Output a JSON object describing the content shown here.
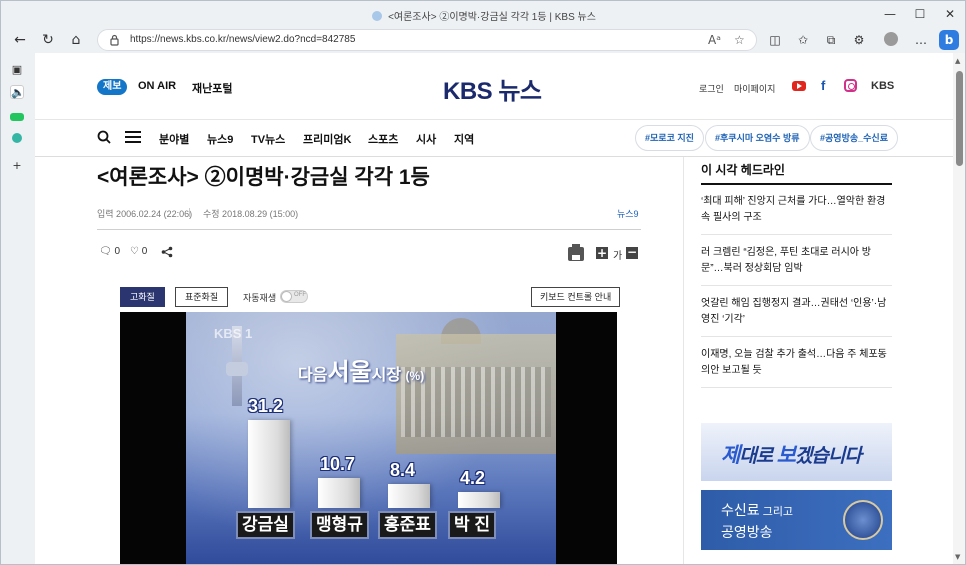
{
  "browser": {
    "window_title": "<여론조사> ②이명박·강금실 각각 1등 | KBS 뉴스",
    "url": "https://news.kbs.co.kr/news/view2.do?ncd=842785",
    "window_controls": {
      "minimize": "—",
      "maximize": "☐",
      "close": "✕"
    }
  },
  "site_header": {
    "report_badge": "제보",
    "on_air": "ON AIR",
    "disaster_portal": "재난포털",
    "logo": "KBS 뉴스",
    "login": "로그인",
    "mypage": "마이페이지",
    "social": {
      "youtube": "youtube-icon",
      "facebook": "f",
      "instagram": "instagram-icon",
      "kbs": "KBS"
    }
  },
  "nav": {
    "items": [
      "분야별",
      "뉴스9",
      "TV뉴스",
      "프리미엄K",
      "스포츠",
      "시사",
      "지역"
    ],
    "hashtags": [
      "#모로코 지진",
      "#후쿠시마 오염수 방류",
      "#공영방송_수신료"
    ]
  },
  "article": {
    "title": "<여론조사> ②이명박·강금실 각각 1등",
    "input_date": "입력 2006.02.24 (22:06)",
    "modified_date": "수정 2018.08.29 (15:00)",
    "category": "뉴스9",
    "comment_count": "0",
    "like_count": "0",
    "font_size_label": "가"
  },
  "video": {
    "hd_label": "고화질",
    "sd_label": "표준화질",
    "autoplay_label": "자동재생",
    "autoplay_state": "OFF",
    "keyboard_guide": "키보드 컨트롤 안내",
    "watermark": "KBS 1",
    "chart_title_prefix": "다음",
    "chart_title_main": "서울",
    "chart_title_suffix": "시장",
    "chart_unit": "(%)"
  },
  "chart_data": {
    "type": "bar",
    "title": "다음서울시장 (%)",
    "categories": [
      "강금실",
      "맹형규",
      "홍준표",
      "박 진"
    ],
    "values": [
      31.2,
      10.7,
      8.4,
      4.2
    ],
    "value_labels": [
      "31.2",
      "10.7",
      "8.4",
      "4.2"
    ],
    "ylabel": "(%)"
  },
  "sidebar": {
    "headline_title": "이 시각 헤드라인",
    "headlines": [
      "‘최대 피해’ 진앙지 근처를 가다…열악한 환경 속 필사의 구조",
      "러 크렘린 “김정은, 푸틴 초대로 러시아 방문”…북러 정상회담 임박",
      "엇갈린 해임 집행정지 결과…권태선 ‘인용’·남영진 ‘기각’",
      "이재명, 오늘 검찰 추가 출석…다음 주 체포동의안 보고될 듯"
    ],
    "banner1_part1": "제",
    "banner1_part2": "대로 ",
    "banner1_part3": "보",
    "banner1_part4": "겠습니다",
    "banner2_line1_main": "수신료",
    "banner2_line1_small": " 그리고",
    "banner2_line2": "공영방송"
  }
}
